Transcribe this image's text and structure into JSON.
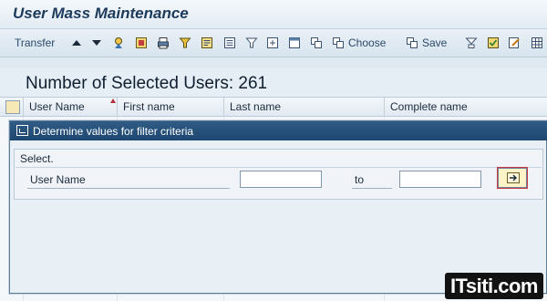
{
  "window": {
    "title": "User Mass Maintenance"
  },
  "toolbar": {
    "transfer_label": "Transfer",
    "choose_label": "Choose",
    "save_label": "Save",
    "icons": [
      "sort-ascending-icon",
      "sort-descending-icon",
      "find-icon",
      "details-icon",
      "print-icon",
      "filter-icon",
      "export-icon",
      "list-view-icon",
      "set-filter-icon",
      "expand-icon",
      "layout-icon",
      "copy-icon",
      "choose-icon",
      "save-icon",
      "variant-icon",
      "check-icon",
      "edit-icon",
      "grid-icon"
    ]
  },
  "summary": {
    "label": "Number of Selected Users: 261",
    "count": 261
  },
  "grid": {
    "columns": [
      "User Name",
      "First name",
      "Last name",
      "Complete name"
    ]
  },
  "dialog": {
    "title": "Determine values for filter criteria",
    "group_title": "Select.",
    "field_label": "User Name",
    "from_value": "",
    "to_label": "to",
    "to_value": ""
  },
  "watermark": {
    "text": "ITsiti.com"
  },
  "colors": {
    "title_bar_dialog": "#1e4770",
    "sort_marker": "#b3313b",
    "exec_button": "#fff3c8"
  }
}
